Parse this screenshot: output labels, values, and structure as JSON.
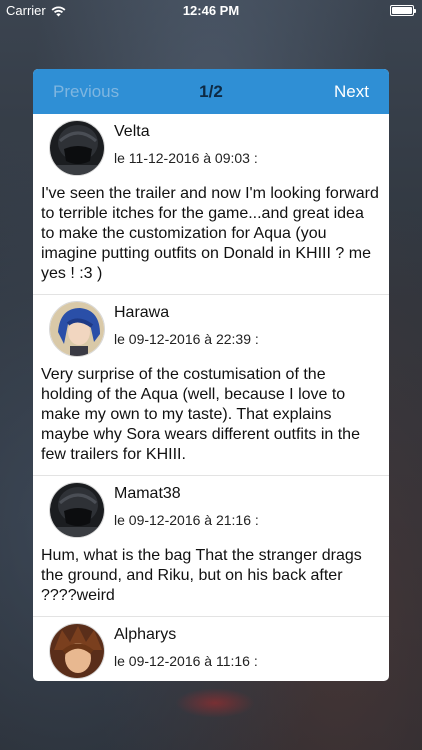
{
  "status_bar": {
    "carrier": "Carrier",
    "time": "12:46 PM"
  },
  "nav": {
    "previous": "Previous",
    "page": "1/2",
    "next": "Next"
  },
  "comments": [
    {
      "author": "Velta",
      "date": "le 11-12-2016 à 09:03 :",
      "text": "I've seen the trailer and now I'm looking forward to terrible itches for the game...and great idea to make the customization for Aqua (you imagine putting outfits on Donald in KHIII ? me yes ! :3 )"
    },
    {
      "author": "Harawa",
      "date": "le 09-12-2016 à 22:39 :",
      "text": "Very surprise of the costumisation of the holding of the Aqua (well, because I love to make my own to my taste). That explains maybe why Sora wears different outfits in the few trailers for KHIII."
    },
    {
      "author": "Mamat38",
      "date": "le 09-12-2016 à 21:16 :",
      "text": "Hum, what is the bag That the stranger drags the ground, and Riku, but on his back after ????weird"
    },
    {
      "author": "Alpharys",
      "date": "le 09-12-2016 à 11:16 :",
      "text": ""
    }
  ],
  "colors": {
    "header": "#2f8fd5",
    "previous_disabled": "#7fb6e0",
    "page_indicator": "#0e2a44"
  }
}
